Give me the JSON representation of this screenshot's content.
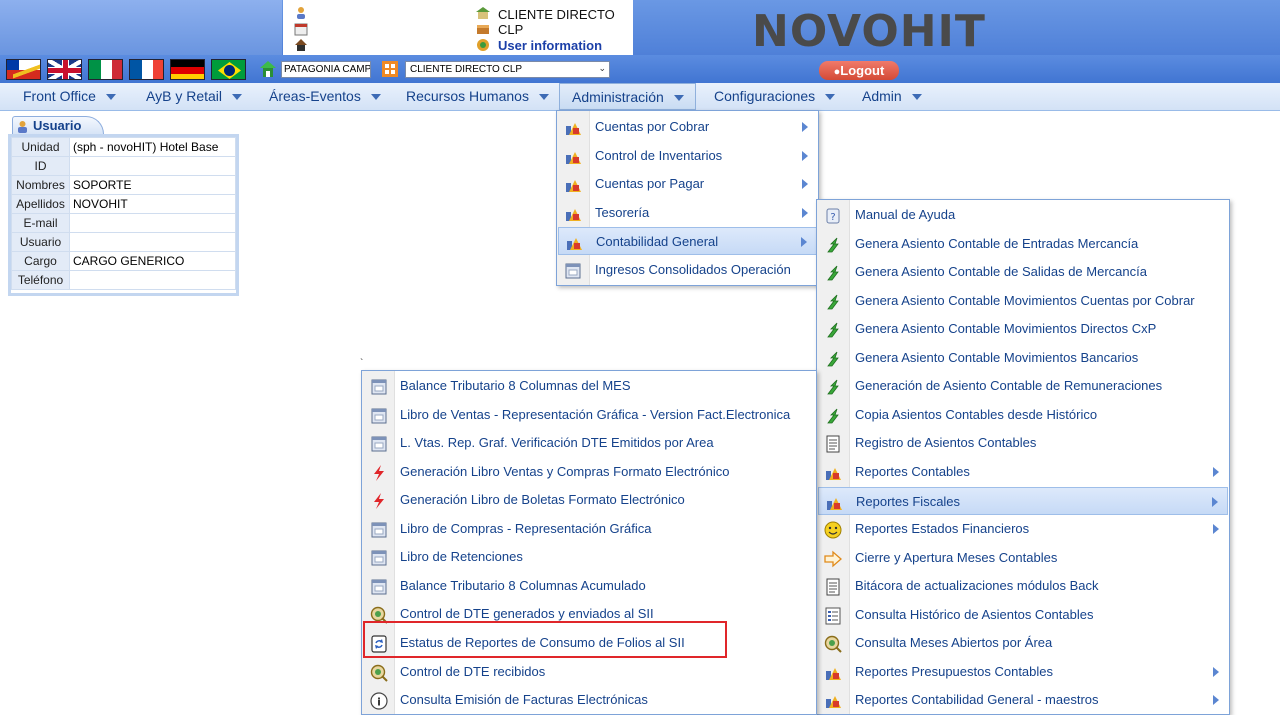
{
  "header": {
    "client_name": "CLIENTE DIRECTO CLP",
    "user_information": "User information",
    "brand": "NOVOHIT"
  },
  "toolbar": {
    "flags": [
      "chile-flag",
      "uk-flag",
      "italy-flag",
      "france-flag",
      "germany-flag",
      "brazil-flag"
    ],
    "camp_value": "PATAGONIA CAMP",
    "client_select_value": "CLIENTE DIRECTO CLP",
    "logout_label": "Logout"
  },
  "menubar": {
    "items": [
      {
        "label": "Front Office"
      },
      {
        "label": "AyB y Retail"
      },
      {
        "label": "Áreas-Eventos"
      },
      {
        "label": "Recursos Humanos"
      },
      {
        "label": "Administración",
        "active": true
      },
      {
        "label": "Configuraciones"
      },
      {
        "label": "Admin"
      }
    ]
  },
  "user_panel": {
    "tab_label": "Usuario",
    "rows": [
      {
        "label": "Unidad",
        "value": "(sph - novoHIT) Hotel Base"
      },
      {
        "label": "ID",
        "value": ""
      },
      {
        "label": "Nombres",
        "value": "SOPORTE"
      },
      {
        "label": "Apellidos",
        "value": "NOVOHIT"
      },
      {
        "label": "E-mail",
        "value": ""
      },
      {
        "label": "Usuario",
        "value": ""
      },
      {
        "label": "Cargo",
        "value": "CARGO GENERICO"
      },
      {
        "label": "Teléfono",
        "value": ""
      }
    ]
  },
  "menu_admin": {
    "items": [
      {
        "label": "Cuentas por Cobrar",
        "icon": "tools-icon",
        "sub": true
      },
      {
        "label": "Control de Inventarios",
        "icon": "tools-icon",
        "sub": true
      },
      {
        "label": "Cuentas por Pagar",
        "icon": "tools-icon",
        "sub": true
      },
      {
        "label": "Tesorería",
        "icon": "tools-icon",
        "sub": true
      },
      {
        "label": "Contabilidad General",
        "icon": "tools-icon",
        "sub": true,
        "active": true
      },
      {
        "label": "Ingresos Consolidados Operación",
        "icon": "window-icon",
        "sub": false
      }
    ]
  },
  "menu_contabilidad": {
    "items": [
      {
        "label": "Manual de Ayuda",
        "icon": "help-icon",
        "sub": false
      },
      {
        "label": "Genera Asiento Contable de Entradas Mercancía",
        "icon": "green-arrow-icon",
        "sub": false
      },
      {
        "label": "Genera Asiento Contable de Salidas de Mercancía",
        "icon": "green-arrow-icon",
        "sub": false
      },
      {
        "label": "Genera Asiento Contable Movimientos Cuentas por Cobrar",
        "icon": "green-arrow-icon",
        "sub": false
      },
      {
        "label": "Genera Asiento Contable Movimientos Directos CxP",
        "icon": "green-arrow-icon",
        "sub": false
      },
      {
        "label": "Genera Asiento Contable Movimientos Bancarios",
        "icon": "green-arrow-icon",
        "sub": false
      },
      {
        "label": "Generación de Asiento Contable de Remuneraciones",
        "icon": "green-arrow-icon",
        "sub": false
      },
      {
        "label": "Copia Asientos Contables desde Histórico",
        "icon": "green-arrow-icon",
        "sub": false
      },
      {
        "label": "Registro de Asientos Contables",
        "icon": "document-icon",
        "sub": false
      },
      {
        "label": "Reportes Contables",
        "icon": "tools-icon",
        "sub": true
      },
      {
        "label": "Reportes Fiscales",
        "icon": "tools-icon",
        "sub": true,
        "active": true
      },
      {
        "label": "Reportes Estados Financieros",
        "icon": "smiley-icon",
        "sub": true
      },
      {
        "label": "Cierre y Apertura Meses Contables",
        "icon": "orange-arrow-icon",
        "sub": false
      },
      {
        "label": "Bitácora de actualizaciones módulos Back",
        "icon": "document-icon",
        "sub": false
      },
      {
        "label": "Consulta Histórico de Asientos Contables",
        "icon": "list-icon",
        "sub": false
      },
      {
        "label": "Consulta Meses Abiertos por Área",
        "icon": "search-icon",
        "sub": false
      },
      {
        "label": "Reportes Presupuestos Contables",
        "icon": "tools-icon",
        "sub": true
      },
      {
        "label": "Reportes Contabilidad General - maestros",
        "icon": "tools-icon",
        "sub": true
      }
    ]
  },
  "menu_fiscales": {
    "items": [
      {
        "label": "Balance Tributario 8 Columnas del MES",
        "icon": "window-icon"
      },
      {
        "label": "Libro de Ventas - Representación Gráfica - Version Fact.Electronica",
        "icon": "window-icon"
      },
      {
        "label": "L. Vtas. Rep. Graf. Verificación DTE Emitidos por Area",
        "icon": "window-icon"
      },
      {
        "label": "Generación Libro Ventas y Compras Formato Electrónico",
        "icon": "lightning-icon"
      },
      {
        "label": "Generación Libro de Boletas Formato Electrónico",
        "icon": "lightning-icon"
      },
      {
        "label": "Libro de Compras - Representación Gráfica",
        "icon": "window-icon"
      },
      {
        "label": "Libro de Retenciones",
        "icon": "window-icon"
      },
      {
        "label": "Balance Tributario 8 Columnas Acumulado",
        "icon": "window-icon"
      },
      {
        "label": "Control de DTE generados y enviados al SII",
        "icon": "search-icon"
      },
      {
        "label": "Estatus de Reportes de Consumo de Folios al SII",
        "icon": "refresh-doc-icon"
      },
      {
        "label": "Control de DTE recibidos",
        "icon": "search-icon"
      },
      {
        "label": "Consulta Emisión de Facturas Electrónicas",
        "icon": "info-icon"
      }
    ]
  },
  "colors": {
    "header_blue": "#4f80d8",
    "menu_text": "#15428b",
    "highlight_red": "#e0262a",
    "logout_red": "#d44a36"
  }
}
